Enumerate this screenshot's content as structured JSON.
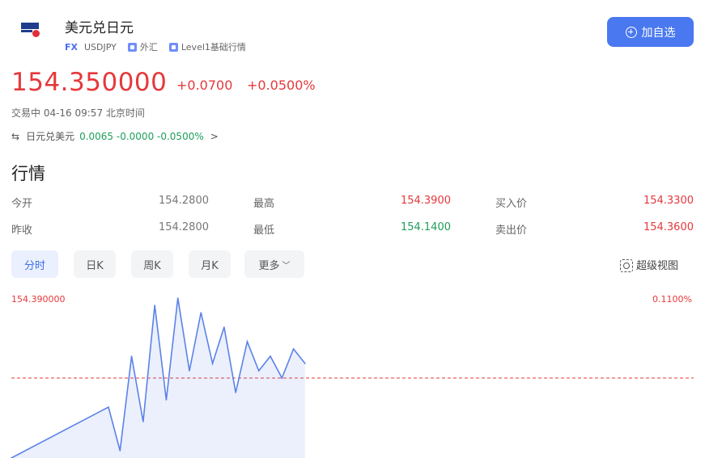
{
  "header": {
    "title": "美元兑日元",
    "tag_fx": "FX",
    "code": "USDJPY",
    "tag_market": "外汇",
    "tag_level": "Level1基础行情",
    "add_button": "加自选"
  },
  "quote": {
    "price": "154.350000",
    "change": "+0.0700",
    "change_pct": "+0.0500%",
    "status": "交易中 04-16 09:57 北京时间",
    "cross_label": "日元兑美元",
    "cross_values": "0.0065 -0.0000 -0.0500%",
    "cross_arrow": ">"
  },
  "section_title": "行情",
  "stats": {
    "open_label": "今开",
    "open": "154.2800",
    "prev_label": "昨收",
    "prev": "154.2800",
    "high_label": "最高",
    "high": "154.3900",
    "low_label": "最低",
    "low": "154.1400",
    "bid_label": "买入价",
    "bid": "154.3300",
    "ask_label": "卖出价",
    "ask": "154.3600"
  },
  "tabs": [
    "分时",
    "日K",
    "周K",
    "月K",
    "更多"
  ],
  "super_view": "超级视图",
  "colors": {
    "up": "#e5383b",
    "down": "#1e9e5a",
    "accent": "#4a78f0",
    "line": "#5b82e8"
  },
  "chart_data": {
    "type": "line",
    "title": "",
    "y_top_label": "154.390000",
    "y_top_pct": "0.1100%",
    "reference_price": 154.28,
    "ylim": [
      154.17,
      154.39
    ],
    "x_count": 60,
    "y": [
      154.17,
      154.24,
      154.18,
      154.31,
      154.22,
      154.38,
      154.25,
      154.39,
      154.29,
      154.37,
      154.3,
      154.35,
      154.26,
      154.33,
      154.29,
      154.31,
      154.28,
      154.32,
      154.3
    ]
  }
}
